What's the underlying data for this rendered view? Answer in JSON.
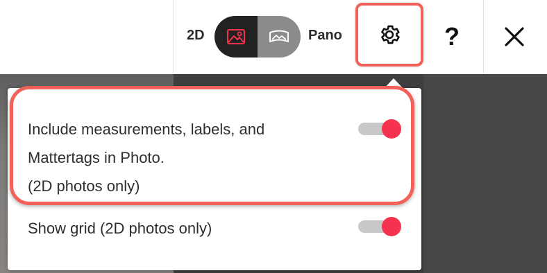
{
  "toolbar": {
    "mode_2d_label": "2D",
    "mode_pano_label": "Pano",
    "help_label": "?",
    "icons": {
      "photo": "image-icon",
      "pano": "panorama-icon",
      "settings": "gear-icon",
      "close": "close-icon"
    }
  },
  "settings_panel": {
    "options": [
      {
        "lines": [
          "Include measurements, labels, and",
          "Mattertags in Photo.",
          "(2D photos only)"
        ],
        "enabled": true
      },
      {
        "lines": [
          "Show grid (2D photos only)"
        ],
        "enabled": true
      }
    ]
  },
  "colors": {
    "accent_toggle": "#f5334f",
    "highlight_annotation": "#f1615a",
    "active_segment": "#222222",
    "inactive_segment": "#8b8b8b"
  }
}
